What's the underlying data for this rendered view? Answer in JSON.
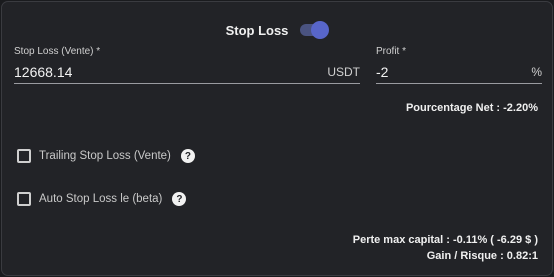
{
  "header": {
    "title": "Stop Loss",
    "toggle_on": true
  },
  "stop_loss": {
    "label": "Stop Loss (Vente) *",
    "value": "12668.14",
    "suffix": "USDT"
  },
  "profit": {
    "label": "Profit *",
    "value": "-2",
    "suffix": "%"
  },
  "net_percentage": "Pourcentage Net : -2.20%",
  "options": [
    {
      "label": "Trailing Stop Loss (Vente)",
      "checked": false,
      "help_icon": "question-circle-icon"
    },
    {
      "label": "Auto Stop Loss le (beta)",
      "checked": false,
      "help_icon": "question-circle-icon"
    }
  ],
  "summary": {
    "max_loss": "Perte max capital : -0.11% ( -6.29 $ )",
    "gain_risk": "Gain / Risque : 0.82:1"
  },
  "colors": {
    "accent": "#5866c9",
    "background": "#222327",
    "border": "#3a3b40"
  }
}
